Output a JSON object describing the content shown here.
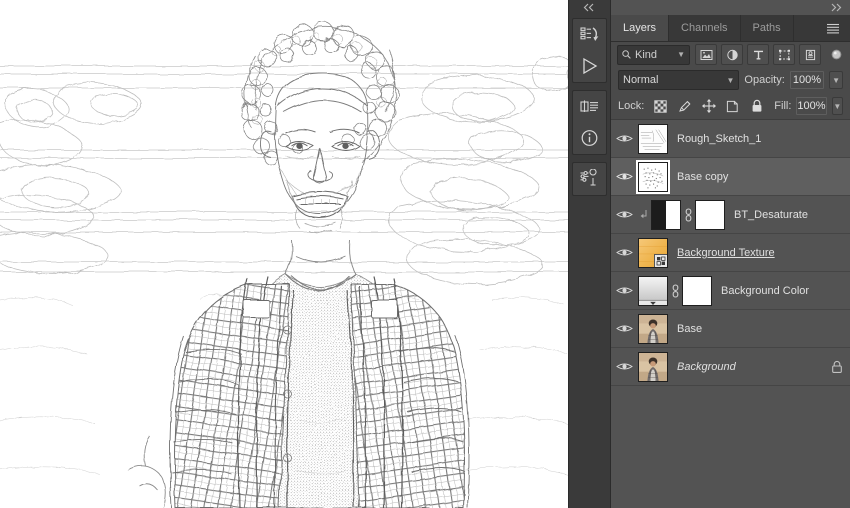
{
  "window": {
    "collapse_left_icon": "chevron-double-left-icon",
    "collapse_right_icon": "chevron-double-right-icon"
  },
  "icon_rail": {
    "groups": [
      {
        "buttons": [
          {
            "name": "history-icon",
            "title": "History"
          },
          {
            "name": "actions-play-icon",
            "title": "Actions"
          }
        ]
      },
      {
        "buttons": [
          {
            "name": "properties-icon",
            "title": "Properties"
          },
          {
            "name": "info-icon",
            "title": "Info"
          }
        ]
      },
      {
        "buttons": [
          {
            "name": "brush-settings-icon",
            "title": "Brush Settings"
          }
        ]
      }
    ]
  },
  "panel": {
    "tabs": [
      {
        "label": "Layers",
        "active": true
      },
      {
        "label": "Channels",
        "active": false
      },
      {
        "label": "Paths",
        "active": false
      }
    ],
    "menu_icon": "panel-menu-icon",
    "filter": {
      "kind_label": "Kind",
      "search_icon": "search-icon",
      "chevron_icon": "chevron-down-icon",
      "icons": [
        {
          "name": "filter-pixel-icon",
          "title": "Filter for pixel layers"
        },
        {
          "name": "filter-adjustment-icon",
          "title": "Filter for adjustment layers"
        },
        {
          "name": "filter-type-icon",
          "title": "Filter for type layers"
        },
        {
          "name": "filter-shape-icon",
          "title": "Filter for shape layers"
        },
        {
          "name": "filter-smart-object-icon",
          "title": "Filter for smart objects"
        }
      ],
      "toggle_icon": "filter-toggle-icon"
    },
    "blend": {
      "mode": "Normal",
      "opacity_label": "Opacity:",
      "opacity_value": "100%"
    },
    "lock": {
      "label": "Lock:",
      "icons": [
        {
          "name": "lock-transparent-pixels-icon"
        },
        {
          "name": "lock-image-pixels-icon"
        },
        {
          "name": "lock-position-icon"
        },
        {
          "name": "lock-artboard-nesting-icon"
        },
        {
          "name": "lock-all-icon"
        }
      ],
      "fill_label": "Fill:",
      "fill_value": "100%"
    },
    "layers": [
      {
        "name": "Rough_Sketch_1",
        "visible": true,
        "selected": false,
        "thumb": "sketch-light",
        "style": "normal",
        "has_mask": false,
        "has_clip": false,
        "locked": false,
        "smart_object": false
      },
      {
        "name": "Base copy",
        "visible": true,
        "selected": true,
        "thumb": "sketch-dense",
        "style": "normal",
        "has_mask": false,
        "has_clip": false,
        "locked": false,
        "smart_object": false
      },
      {
        "name": "BT_Desaturate",
        "visible": true,
        "selected": false,
        "thumb": "gradient-map",
        "style": "normal",
        "has_mask": true,
        "has_clip": true,
        "locked": false,
        "smart_object": false
      },
      {
        "name": "Background Texture ",
        "visible": true,
        "selected": false,
        "thumb": "texture-orange",
        "style": "underline",
        "has_mask": false,
        "has_clip": false,
        "locked": false,
        "smart_object": true
      },
      {
        "name": "Background Color",
        "visible": true,
        "selected": false,
        "thumb": "gradient-fill",
        "style": "normal",
        "has_mask": true,
        "has_clip": false,
        "locked": false,
        "smart_object": false
      },
      {
        "name": "Base",
        "visible": true,
        "selected": false,
        "thumb": "photo",
        "style": "normal",
        "has_mask": false,
        "has_clip": false,
        "locked": false,
        "smart_object": false
      },
      {
        "name": "Background",
        "visible": true,
        "selected": false,
        "thumb": "photo",
        "style": "italic",
        "has_mask": false,
        "has_clip": false,
        "locked": true,
        "smart_object": false
      }
    ]
  },
  "canvas": {
    "description": "Pencil sketch line-art rendering of a smiling person with curly hair wearing a plaid shirt over a t-shirt, with a horizontal landscape background",
    "background_color": "#ffffff",
    "line_color": "#6e6e6e"
  },
  "colors": {
    "panel_bg": "#4a4a4a",
    "list_bg": "#535353",
    "selected_row": "#5f5f5f",
    "rail_bg": "#3a3a3a",
    "tab_bg": "#383838",
    "text": "#e0e0e0",
    "field_bg": "#383838",
    "texture_orange": "#f0b757"
  }
}
